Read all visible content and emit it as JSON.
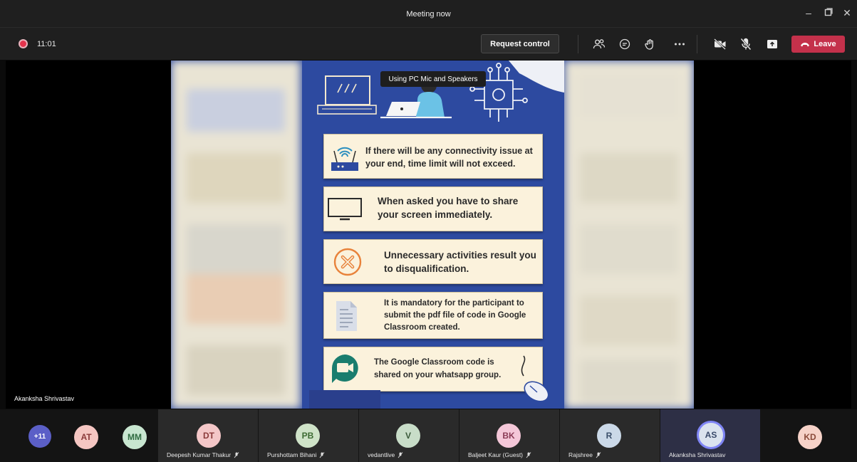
{
  "window": {
    "title": "Meeting now",
    "controls": [
      "minimize-icon",
      "maximize-icon",
      "close-icon"
    ]
  },
  "toolbar": {
    "recording_icon": "record-dot-icon",
    "timer": "11:01",
    "request_control": "Request control",
    "icons": [
      "participants-icon",
      "chat-icon",
      "reactions-icon",
      "more-icon",
      "camera-off-icon",
      "mic-off-icon",
      "share-tray-icon"
    ],
    "leave": "Leave",
    "leave_color": "#c4314b"
  },
  "tooltip": "Using PC Mic and Speakers",
  "poster": {
    "cards": [
      {
        "icon": "wifi-router-icon",
        "text": "If there will be any connectivity issue at your end, time limit will not exceed."
      },
      {
        "icon": "monitor-icon",
        "text": "When asked you have to share your screen immediately."
      },
      {
        "icon": "cancel-circle-icon",
        "text": "Unnecessary activities result you to disqualification."
      },
      {
        "icon": "document-icon",
        "text": "It is mandatory for the participant to submit the pdf file of code in Google Classroom created."
      },
      {
        "icon": "google-meet-icon",
        "text": "The Google Classroom code is shared on your whatsapp group."
      }
    ],
    "background_color": "#2d4aa0"
  },
  "stage": {
    "speaker_name": "Akanksha Shrivastav"
  },
  "participants": {
    "overflow": "+11",
    "list": [
      {
        "initials": "AT",
        "name": "",
        "color": "#f5c6c2",
        "fg": "#8a3a3a"
      },
      {
        "initials": "MM",
        "name": "",
        "color": "#c8e6d0",
        "fg": "#2f6b40"
      },
      {
        "initials": "DT",
        "name": "Deepesh Kumar Thakur",
        "color": "#f4c7c8",
        "fg": "#8a3a3a"
      },
      {
        "initials": "PB",
        "name": "Purshottam Bihani",
        "color": "#cfe3c8",
        "fg": "#3c6a32"
      },
      {
        "initials": "V",
        "name": "vedantlive",
        "color": "#c8ddc8",
        "fg": "#3a5a3a"
      },
      {
        "initials": "BK",
        "name": "Baljeet Kaur (Guest)",
        "color": "#f4c7d8",
        "fg": "#8a3a55"
      },
      {
        "initials": "R",
        "name": "Rajshree",
        "color": "#cbd9e8",
        "fg": "#3a4f6a"
      },
      {
        "initials": "AS",
        "name": "Akanksha Shrivastav",
        "color": "#dbe3ee",
        "fg": "#3a4a6a"
      },
      {
        "initials": "KD",
        "name": "",
        "color": "#f6d2c8",
        "fg": "#8a4a3a"
      }
    ]
  }
}
